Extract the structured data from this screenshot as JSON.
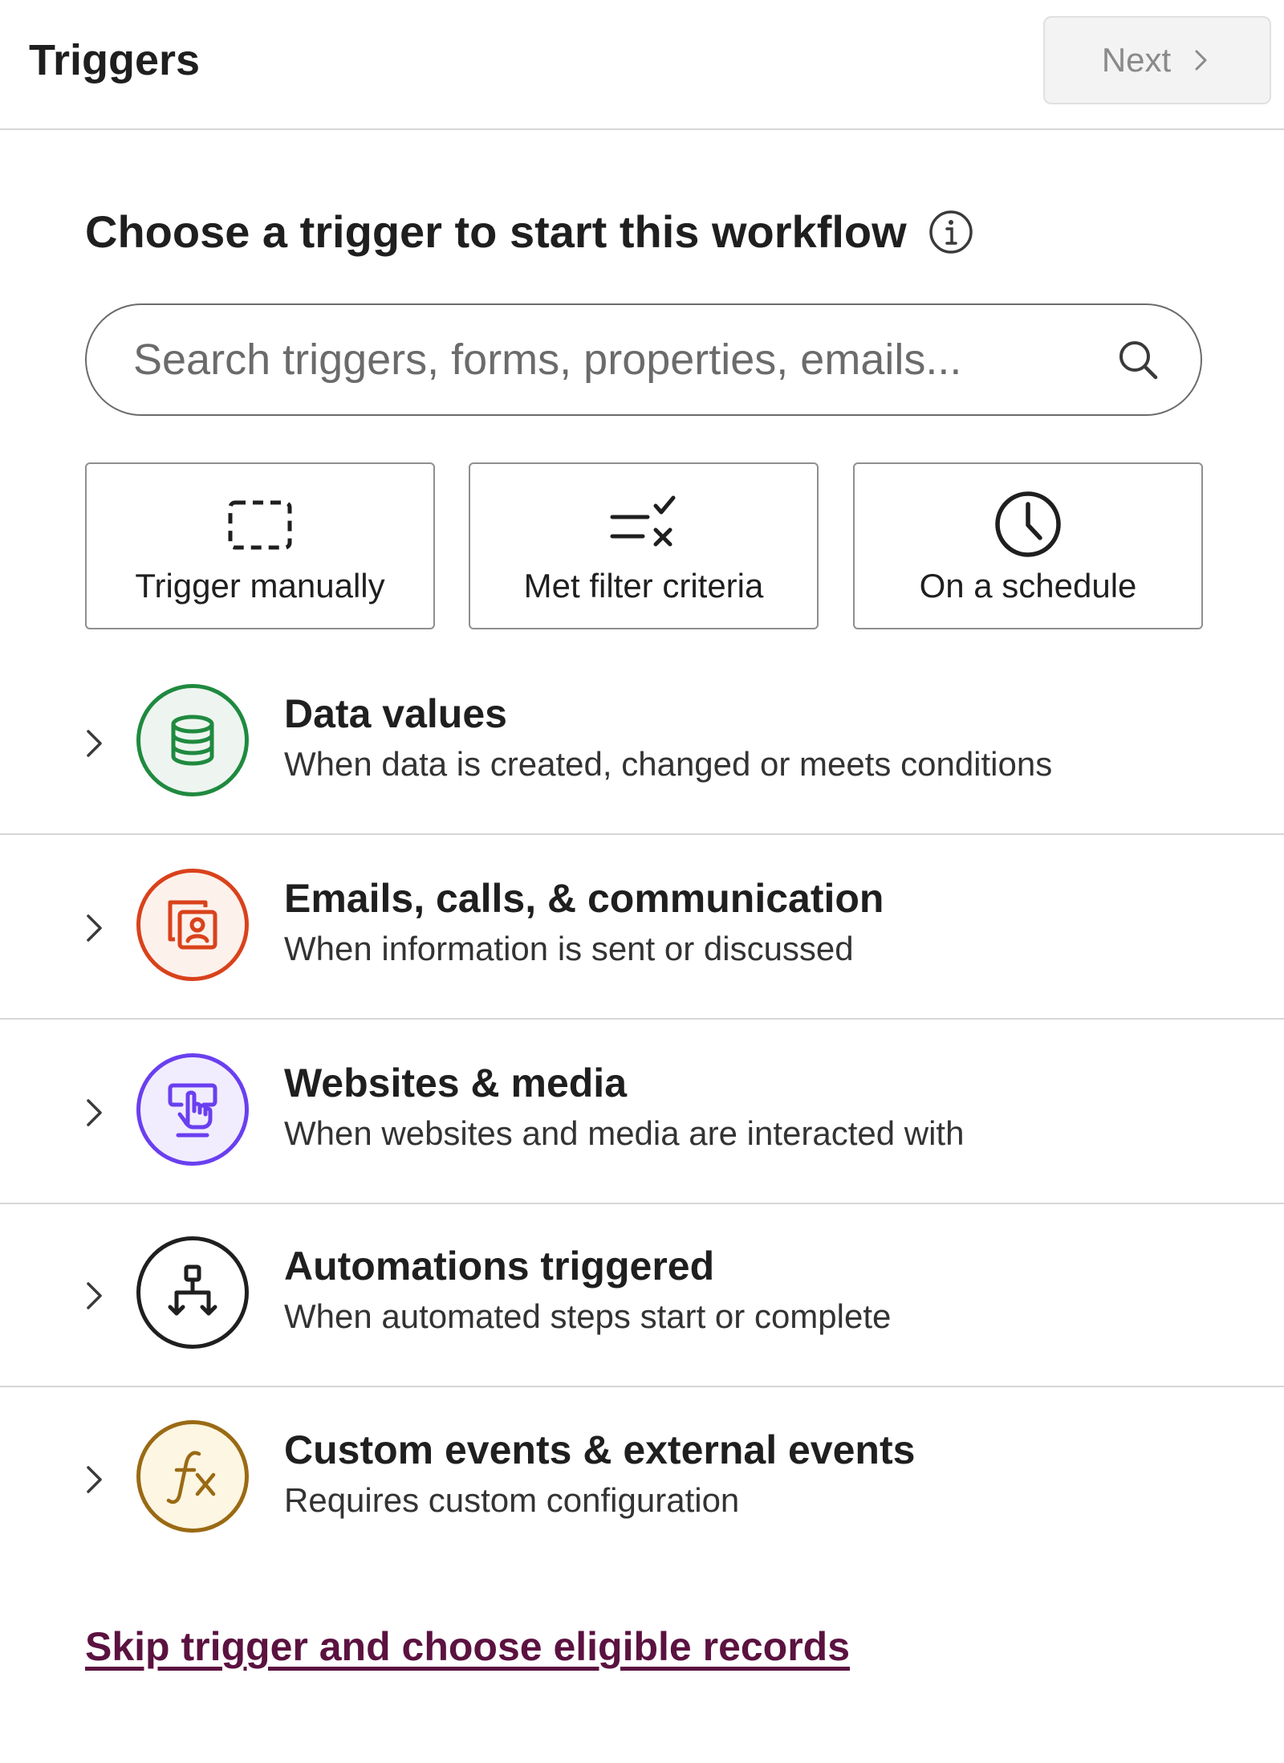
{
  "header": {
    "title": "Triggers",
    "next_label": "Next"
  },
  "main": {
    "heading": "Choose a trigger to start this workflow",
    "search": {
      "placeholder": "Search triggers, forms, properties, emails..."
    },
    "quick_triggers": [
      {
        "label": "Trigger manually",
        "icon": "dashed-square-icon"
      },
      {
        "label": "Met filter criteria",
        "icon": "filter-criteria-icon"
      },
      {
        "label": "On a schedule",
        "icon": "clock-icon"
      }
    ],
    "categories": [
      {
        "title": "Data values",
        "description": "When data is created, changed or meets conditions",
        "icon": "database-icon",
        "color": "#1f8a3f"
      },
      {
        "title": "Emails, calls, & communication",
        "description": "When information is sent or discussed",
        "icon": "contact-card-icon",
        "color": "#d9421b"
      },
      {
        "title": "Websites & media",
        "description": "When websites and media are interacted with",
        "icon": "pointer-click-icon",
        "color": "#6a3ff0"
      },
      {
        "title": "Automations triggered",
        "description": "When automated steps start or complete",
        "icon": "workflow-tree-icon",
        "color": "#1f1f1f"
      },
      {
        "title": "Custom events & external events",
        "description": "Requires custom configuration",
        "icon": "function-fx-icon",
        "color": "#9a6a14"
      }
    ],
    "skip_link": "Skip trigger and choose eligible records"
  }
}
